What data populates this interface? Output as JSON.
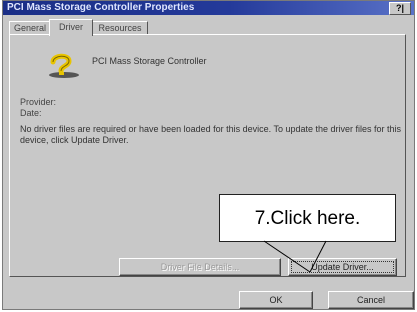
{
  "window": {
    "title": "PCI Mass Storage Controller Properties",
    "help_button": "?|"
  },
  "tabs": [
    {
      "label": "General",
      "active": false
    },
    {
      "label": "Driver",
      "active": true
    },
    {
      "label": "Resources",
      "active": false
    }
  ],
  "driver": {
    "device_name": "PCI Mass Storage Controller",
    "provider_label": "Provider:",
    "date_label": "Date:",
    "message": "No driver files are required or have been loaded for this device.  To update the driver files for this device, click Update Driver.",
    "driver_file_details_button": "Driver File Details...",
    "update_driver_button": "Update Driver..."
  },
  "footer": {
    "ok_button": "OK",
    "cancel_button": "Cancel"
  },
  "annotation": {
    "callout_text": "7.Click here."
  },
  "icons": {
    "device_icon": "question-mark-device-icon"
  },
  "colors": {
    "titlebar_start": "#1a2e86",
    "titlebar_end": "#5a72c8",
    "dialog_bg": "#c8c8c8",
    "icon_yellow": "#e8c400"
  }
}
